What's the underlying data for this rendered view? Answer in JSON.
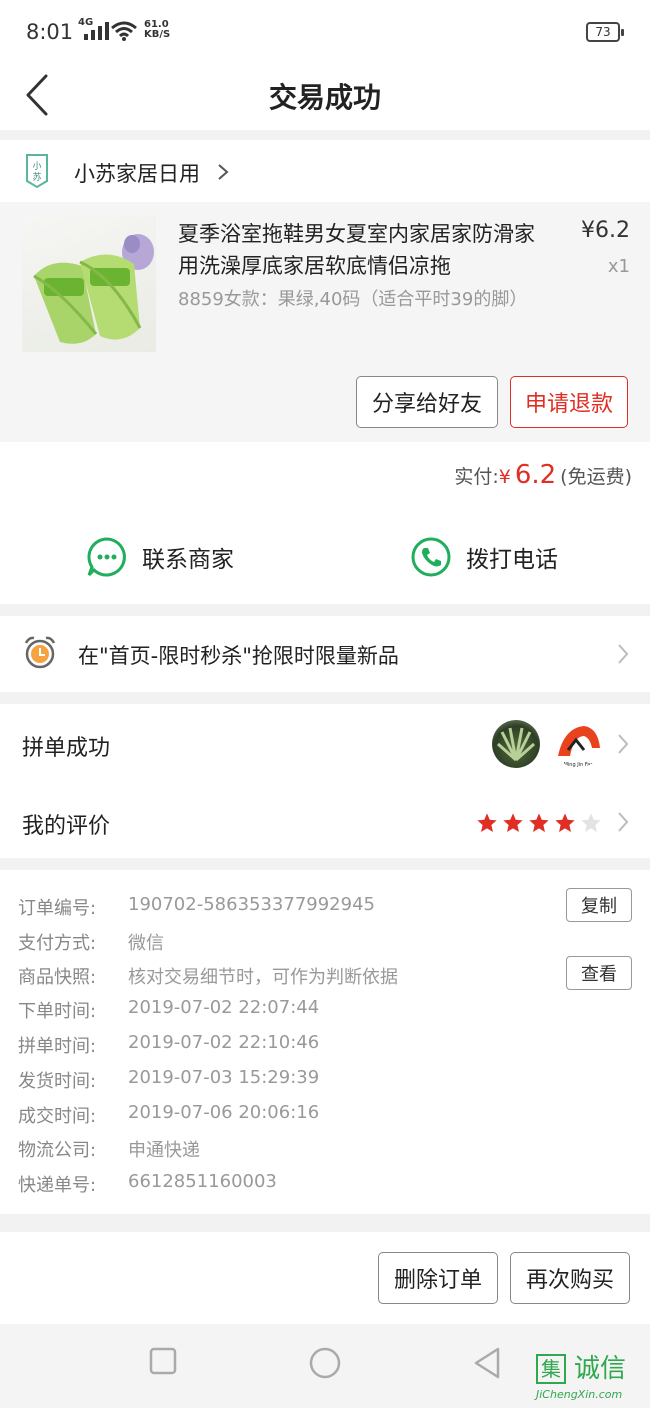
{
  "status_bar": {
    "time": "8:01",
    "network": "4G",
    "speed_value": "61.0",
    "speed_unit": "KB/S",
    "battery": "73"
  },
  "nav": {
    "title": "交易成功"
  },
  "shop": {
    "name": "小苏家居日用",
    "logo_text": "小苏"
  },
  "product": {
    "title": "夏季浴室拖鞋男女夏室内家居家防滑家用洗澡厚底家居软底情侣凉拖",
    "price": "¥6.2",
    "quantity": "x1",
    "sku": "8859女款：果绿,40码（适合平时39的脚）",
    "share_label": "分享给好友",
    "refund_label": "申请退款"
  },
  "payment": {
    "paid_label": "实付:",
    "currency": "¥",
    "amount": "6.2",
    "shipping_note": "(免运费)"
  },
  "contact": {
    "merchant_label": "联系商家",
    "phone_label": "拨打电话"
  },
  "promo": {
    "text": "在\"首页-限时秒杀\"抢限时限量新品"
  },
  "group": {
    "label": "拼单成功",
    "avatar2_caption": "Ming Jin Far"
  },
  "review": {
    "label": "我的评价",
    "rating": 4,
    "max_rating": 5
  },
  "order_info": {
    "copy_label": "复制",
    "view_label": "查看",
    "rows": [
      {
        "key": "订单编号:",
        "value": "190702-586353377992945"
      },
      {
        "key": "支付方式:",
        "value": "微信"
      },
      {
        "key": "商品快照:",
        "value": "核对交易细节时，可作为判断依据"
      },
      {
        "key": "下单时间:",
        "value": "2019-07-02 22:07:44"
      },
      {
        "key": "拼单时间:",
        "value": "2019-07-02 22:10:46"
      },
      {
        "key": "发货时间:",
        "value": "2019-07-03 15:29:39"
      },
      {
        "key": "成交时间:",
        "value": "2019-07-06 20:06:16"
      },
      {
        "key": "物流公司:",
        "value": "申通快递"
      },
      {
        "key": "快递单号:",
        "value": "6612851160003"
      }
    ]
  },
  "actions": {
    "delete_label": "删除订单",
    "rebuy_label": "再次购买"
  },
  "watermark": {
    "mark": "集",
    "text": "诚信",
    "sub": "JiChengXin.com"
  },
  "colors": {
    "accent_red": "#e02e24",
    "star_red": "#e02e24",
    "contact_green": "#1fae5b"
  }
}
